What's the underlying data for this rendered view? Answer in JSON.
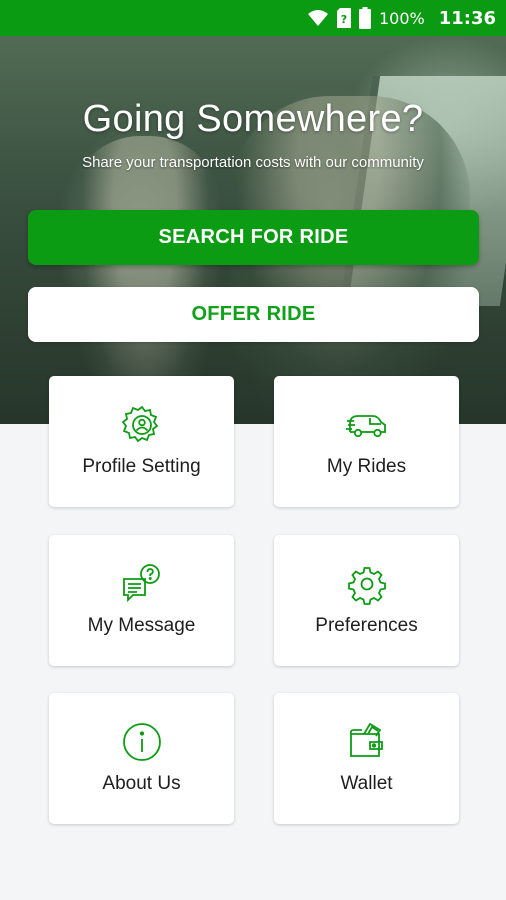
{
  "status_bar": {
    "battery_percent": "100%",
    "time": "11:36",
    "icons": [
      "wifi-icon",
      "sim-unknown-icon",
      "battery-icon"
    ]
  },
  "hero": {
    "title": "Going Somewhere?",
    "subtitle": "Share your transportation costs with our community"
  },
  "actions": {
    "search_label": "SEARCH FOR RIDE",
    "offer_label": "OFFER RIDE"
  },
  "menu": [
    {
      "label": "Profile Setting",
      "icon": "profile-gear-icon"
    },
    {
      "label": "My Rides",
      "icon": "car-icon"
    },
    {
      "label": "My Message",
      "icon": "message-icon"
    },
    {
      "label": "Preferences",
      "icon": "gear-icon"
    },
    {
      "label": "About Us",
      "icon": "info-icon"
    },
    {
      "label": "Wallet",
      "icon": "wallet-icon"
    }
  ],
  "colors": {
    "brand_green": "#0c9c14",
    "accent_text_green": "#11a01a",
    "background": "#f4f5f7"
  }
}
